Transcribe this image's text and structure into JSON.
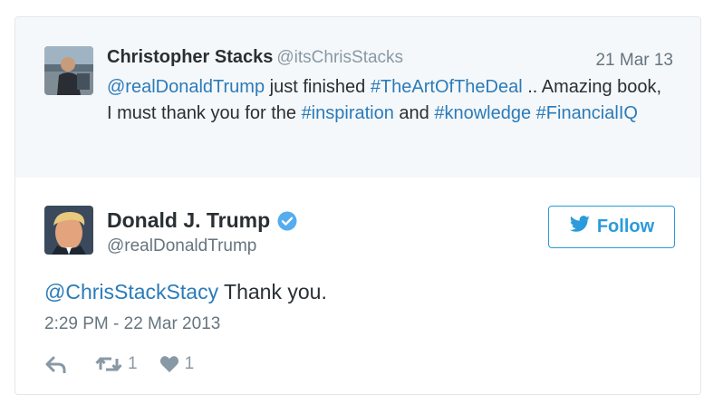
{
  "quoted_tweet": {
    "author_name": "Christopher Stacks",
    "author_handle": "@itsChrisStacks",
    "date": "21 Mar 13",
    "text_parts": {
      "mention": "@realDonaldTrump",
      "t1": " just finished ",
      "hashtag1": "#TheArtOfTheDeal",
      "t2": " .. Amazing book, I must thank you for the ",
      "hashtag2": "#inspiration",
      "t3": " and ",
      "hashtag3": "#knowledge",
      "t4": " ",
      "hashtag4": "#FinancialIQ"
    }
  },
  "main_tweet": {
    "author_name": "Donald J. Trump",
    "author_handle": "@realDonaldTrump",
    "follow_label": "Follow",
    "text_parts": {
      "mention": "@ChrisStackStacy",
      "t1": " Thank you."
    },
    "timestamp": "2:29 PM - 22 Mar 2013",
    "retweet_count": "1",
    "like_count": "1"
  },
  "colors": {
    "link": "#2b7bb9",
    "follow_accent": "#2b9bdb",
    "verified_badge": "#55acee",
    "quoted_background": "#f5f8fa"
  },
  "icons": [
    "verified-icon",
    "twitter-bird-icon",
    "reply-icon",
    "retweet-icon",
    "heart-icon"
  ]
}
